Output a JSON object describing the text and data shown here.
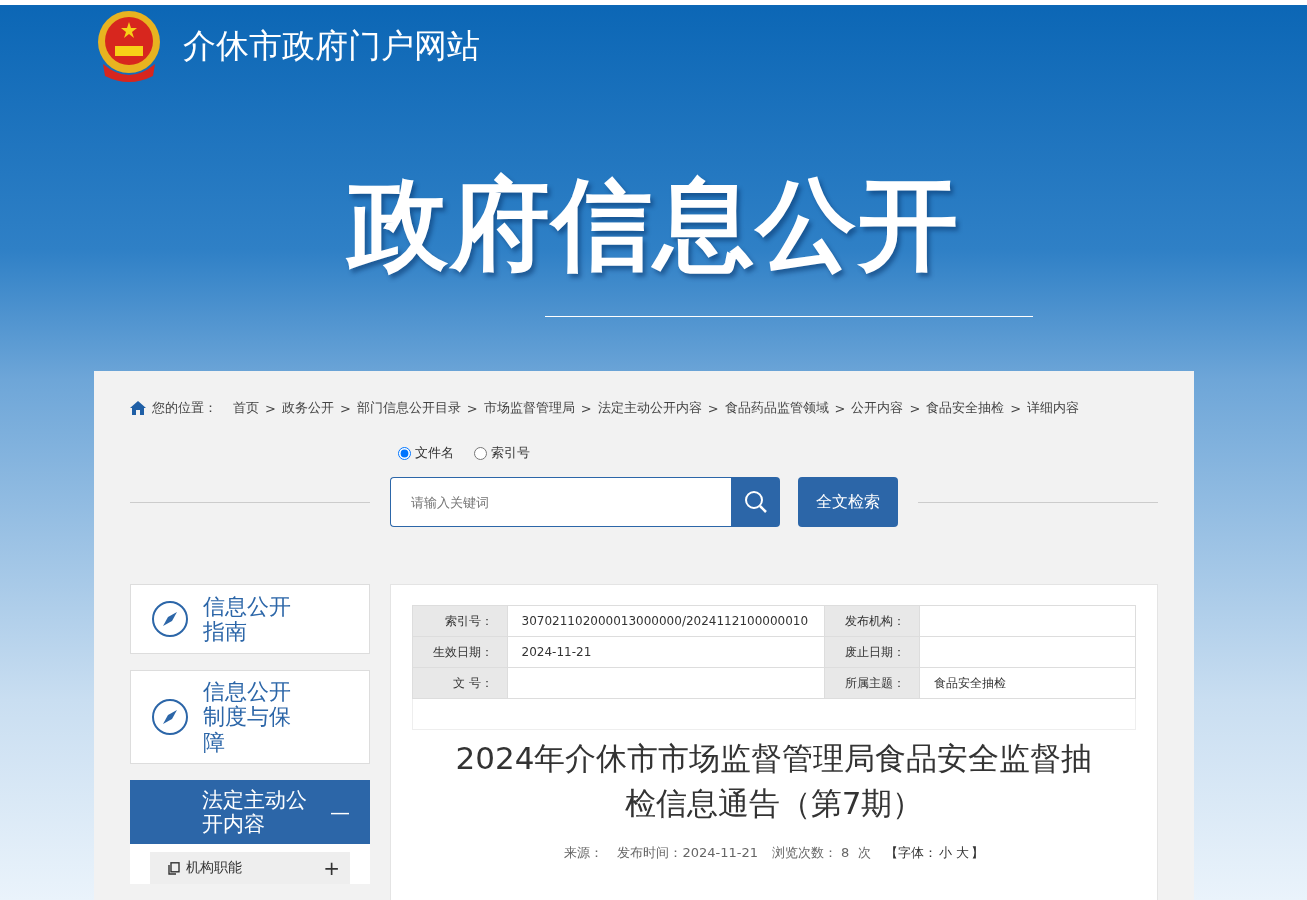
{
  "header": {
    "site_title": "介休市政府门户网站",
    "banner_title": "政府信息公开"
  },
  "breadcrumb": {
    "label": "您的位置：",
    "separator": ">",
    "items": [
      "首页",
      "政务公开",
      "部门信息公开目录",
      "市场监督管理局",
      "法定主动公开内容",
      "食品药品监管领域",
      "公开内容",
      "食品安全抽检",
      "详细内容"
    ]
  },
  "search": {
    "options": [
      {
        "label": "文件名",
        "selected": true
      },
      {
        "label": "索引号",
        "selected": false
      }
    ],
    "placeholder": "请输入关键词",
    "fulltext_button": "全文检索"
  },
  "sidebar": {
    "items": [
      {
        "label": "信息公开指南",
        "kind": "link"
      },
      {
        "label": "信息公开制度与保障",
        "kind": "link"
      },
      {
        "label": "法定主动公开内容",
        "kind": "section",
        "expanded": true,
        "toggle": "—",
        "children": [
          {
            "label": "机构职能",
            "expanded": false,
            "toggle": "+"
          }
        ]
      }
    ]
  },
  "article": {
    "meta_rows": [
      [
        "索引号：",
        "307021102000013000000/2024112100000010",
        "发布机构：",
        ""
      ],
      [
        "生效日期：",
        "2024-11-21",
        "废止日期：",
        ""
      ],
      [
        "文 号：",
        "",
        "所属主题：",
        "食品安全抽检"
      ]
    ],
    "title": "2024年介休市市场监督管理局食品安全监督抽检信息通告（第7期）",
    "info": {
      "source": "来源：",
      "published": "发布时间：2024-11-21",
      "views": "浏览次数： 8  次",
      "font_prefix": "【字体：",
      "font_options": [
        "小",
        "大"
      ],
      "font_suffix": "】"
    }
  }
}
